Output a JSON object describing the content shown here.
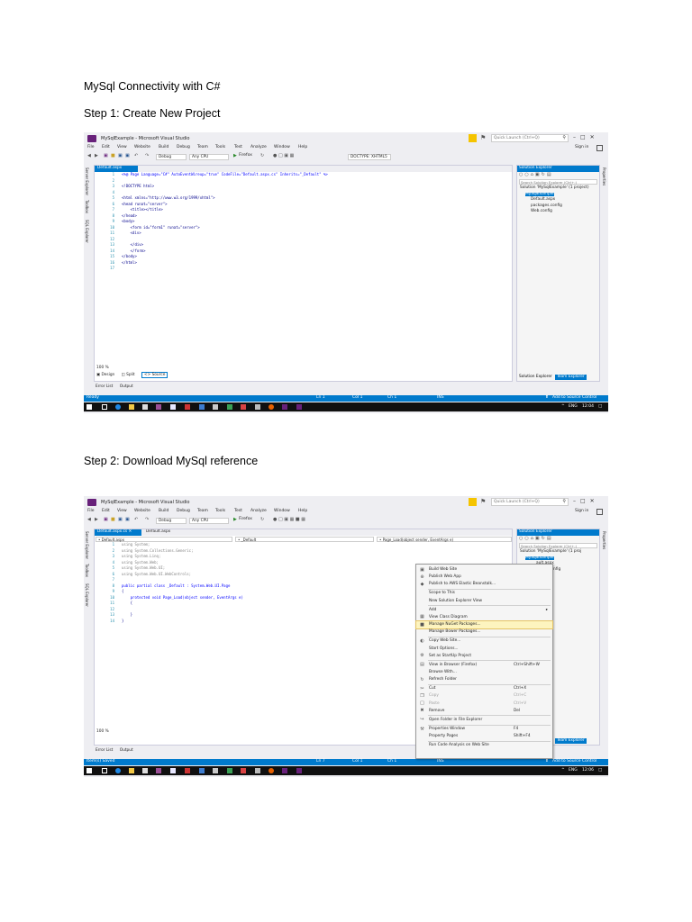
{
  "doc": {
    "heading": "MySql Connectivity with C#",
    "step1": "Step 1: Create New Project",
    "step2": "Step 2: Download MySql reference"
  },
  "vs": {
    "app_title": "MySqlExample - Microsoft Visual Studio",
    "quick_launch": "Quick Launch (Ctrl+Q)",
    "sign_in": "Sign in",
    "menu": [
      "File",
      "Edit",
      "View",
      "Website",
      "Build",
      "Debug",
      "Team",
      "Tools",
      "Test",
      "Analyze",
      "Window",
      "Help"
    ],
    "config": "Debug",
    "platform": "Any CPU",
    "browser": "Firefox",
    "doctype": "DOCTYPE: XHTML5",
    "left_rail": [
      "Server Explorer",
      "Toolbox",
      "SQL Explorer"
    ],
    "right_rail": "Properties",
    "solution_explorer_title": "Solution Explorer",
    "solution_search": "Search Solution Explorer (Ctrl+;)",
    "team_explorer": "Team Explorer",
    "error_list": "Error List",
    "output": "Output",
    "zoom": "100 %",
    "accent": "#007acc"
  },
  "shot1": {
    "tab1": "Default.aspx",
    "tab1_close": "✖",
    "code": [
      {
        "n": "1",
        "t": "<%@ Page Language=\"C#\" AutoEventWireup=\"true\" CodeFile=\"Default.aspx.cs\" Inherits=\"_Default\" %>",
        "c": "kw"
      },
      {
        "n": "2",
        "t": "",
        "c": ""
      },
      {
        "n": "3",
        "t": "<!DOCTYPE html>",
        "c": ""
      },
      {
        "n": "4",
        "t": "",
        "c": ""
      },
      {
        "n": "5",
        "t": "<html xmlns=\"http://www.w3.org/1999/xhtml\">",
        "c": ""
      },
      {
        "n": "6",
        "t": "<head runat=\"server\">",
        "c": ""
      },
      {
        "n": "7",
        "t": "    <title></title>",
        "c": ""
      },
      {
        "n": "8",
        "t": "</head>",
        "c": ""
      },
      {
        "n": "9",
        "t": "<body>",
        "c": ""
      },
      {
        "n": "10",
        "t": "    <form id=\"form1\" runat=\"server\">",
        "c": ""
      },
      {
        "n": "11",
        "t": "    <div>",
        "c": ""
      },
      {
        "n": "12",
        "t": "",
        "c": ""
      },
      {
        "n": "13",
        "t": "    </div>",
        "c": ""
      },
      {
        "n": "14",
        "t": "    </form>",
        "c": ""
      },
      {
        "n": "15",
        "t": "</body>",
        "c": ""
      },
      {
        "n": "16",
        "t": "</html>",
        "c": ""
      },
      {
        "n": "17",
        "t": "",
        "c": ""
      }
    ],
    "design": "Design",
    "split": "Split",
    "source": "Source",
    "tree": [
      {
        "t": "Solution 'MySqlExample' (1 project)",
        "sel": false,
        "indent": 0
      },
      {
        "t": "MySqlExample",
        "sel": true,
        "indent": 1
      },
      {
        "t": "Default.aspx",
        "sel": false,
        "indent": 2
      },
      {
        "t": "packages.config",
        "sel": false,
        "indent": 2
      },
      {
        "t": "Web.config",
        "sel": false,
        "indent": 2
      }
    ],
    "status": {
      "ready": "Ready",
      "ln": "Ln 1",
      "col": "Col 1",
      "ch": "Ch 1",
      "ins": "INS",
      "add_source": "Add to Source Control"
    },
    "tray": {
      "lang": "ENG",
      "time": "12:04"
    }
  },
  "shot2": {
    "tab1": "Default.aspx.cs",
    "tab2": "Default.aspx",
    "nav1": "• Default.aspx",
    "nav2": "• _Default",
    "nav3": "• Page_Load(object sender, EventArgs e)",
    "code": [
      {
        "n": "1",
        "t": "using System;",
        "c": "cm"
      },
      {
        "n": "2",
        "t": "using System.Collections.Generic;",
        "c": "cm"
      },
      {
        "n": "3",
        "t": "using System.Linq;",
        "c": "cm"
      },
      {
        "n": "4",
        "t": "using System.Web;",
        "c": "cm"
      },
      {
        "n": "5",
        "t": "using System.Web.UI;",
        "c": "cm"
      },
      {
        "n": "6",
        "t": "using System.Web.UI.WebControls;",
        "c": "cm"
      },
      {
        "n": "7",
        "t": "",
        "c": ""
      },
      {
        "n": "8",
        "t": "public partial class _Default : System.Web.UI.Page",
        "c": "kw"
      },
      {
        "n": "9",
        "t": "{",
        "c": ""
      },
      {
        "n": "10",
        "t": "    protected void Page_Load(object sender, EventArgs e)",
        "c": "kw"
      },
      {
        "n": "11",
        "t": "    {",
        "c": ""
      },
      {
        "n": "12",
        "t": "",
        "c": ""
      },
      {
        "n": "13",
        "t": "    }",
        "c": ""
      },
      {
        "n": "14",
        "t": "}",
        "c": ""
      }
    ],
    "tree": [
      {
        "t": "Solution 'MySqlExample' (1 proj",
        "sel": false,
        "indent": 0
      },
      {
        "t": "MySqlExample",
        "sel": true,
        "indent": 1
      },
      {
        "t": "ault.aspx",
        "sel": false,
        "indent": 3
      },
      {
        "t": "kages.config",
        "sel": false,
        "indent": 3
      },
      {
        "t": "b.config",
        "sel": false,
        "indent": 3
      }
    ],
    "context_menu": [
      {
        "label": "Build Web Site",
        "icon": "build-icon",
        "g": "▣"
      },
      {
        "label": "Publish Web App",
        "icon": "globe-icon",
        "g": "⊕"
      },
      {
        "label": "Publish to AWS Elastic Beanstalk...",
        "icon": "aws-icon",
        "g": "◆"
      },
      {
        "sep": true
      },
      {
        "label": "Scope to This",
        "icon": "",
        "g": ""
      },
      {
        "label": "New Solution Explorer View",
        "icon": "",
        "g": ""
      },
      {
        "sep": true
      },
      {
        "label": "Add",
        "icon": "",
        "g": "",
        "sub": "▸"
      },
      {
        "label": "View Class Diagram",
        "icon": "class-diagram-icon",
        "g": "▦"
      },
      {
        "label": "Manage NuGet Packages...",
        "icon": "nuget-icon",
        "g": "■",
        "hl": true
      },
      {
        "label": "Manage Bower Packages...",
        "icon": "",
        "g": ""
      },
      {
        "sep": true
      },
      {
        "label": "Copy Web Site...",
        "icon": "copy-site-icon",
        "g": "◐"
      },
      {
        "label": "Start Options...",
        "icon": "",
        "g": ""
      },
      {
        "label": "Set as StartUp Project",
        "icon": "gear-icon",
        "g": "⚙"
      },
      {
        "sep": true
      },
      {
        "label": "View in Browser (Firefox)",
        "icon": "browser-icon",
        "g": "▤",
        "sc": "Ctrl+Shift+W"
      },
      {
        "label": "Browse With...",
        "icon": "",
        "g": ""
      },
      {
        "label": "Refresh Folder",
        "icon": "refresh-icon",
        "g": "↻"
      },
      {
        "sep": true
      },
      {
        "label": "Cut",
        "icon": "cut-icon",
        "g": "✂",
        "sc": "Ctrl+X"
      },
      {
        "label": "Copy",
        "icon": "copy-icon",
        "g": "❐",
        "sc": "Ctrl+C",
        "dis": true
      },
      {
        "label": "Paste",
        "icon": "paste-icon",
        "g": "□",
        "sc": "Ctrl+V",
        "dis": true
      },
      {
        "label": "Remove",
        "icon": "remove-icon",
        "g": "✖",
        "sc": "Del"
      },
      {
        "sep": true
      },
      {
        "label": "Open Folder in File Explorer",
        "icon": "folder-open-icon",
        "g": "↪"
      },
      {
        "sep": true
      },
      {
        "label": "Properties Window",
        "icon": "wrench-icon",
        "g": "⚒",
        "sc": "F4"
      },
      {
        "label": "Property Pages",
        "icon": "",
        "g": "",
        "sc": "Shift+F4"
      },
      {
        "sep": true
      },
      {
        "label": "Run Code Analysis on Web Site",
        "icon": "",
        "g": ""
      }
    ],
    "status": {
      "ready": "Item(s) Saved",
      "ln": "Ln 7",
      "col": "Col 1",
      "ch": "Ch 1",
      "ins": "INS",
      "add_source": "Add to Source Control"
    },
    "tray": {
      "lang": "ENG",
      "time": "12:06"
    }
  }
}
